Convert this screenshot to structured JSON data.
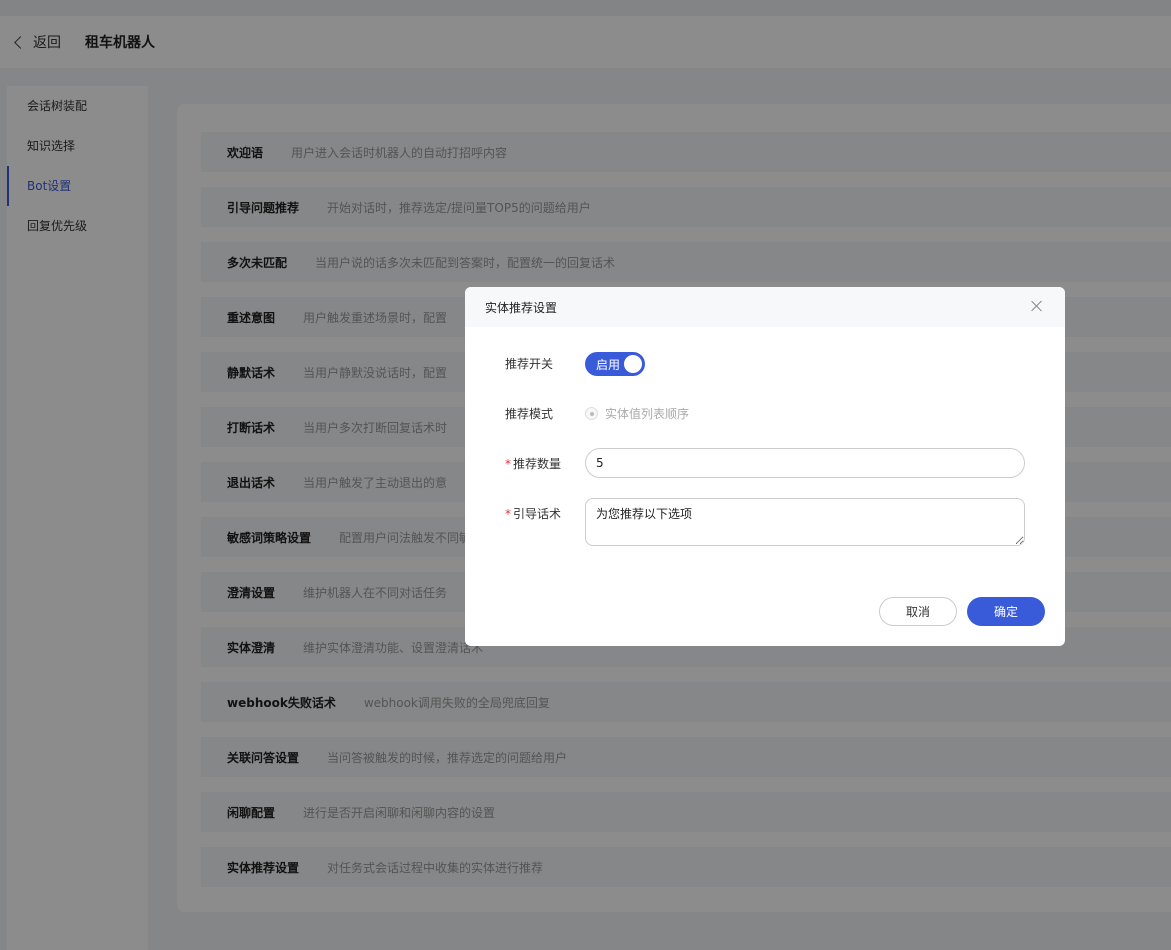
{
  "header": {
    "back_label": "返回",
    "title": "租车机器人"
  },
  "sidebar": {
    "items": [
      {
        "label": "会话树装配"
      },
      {
        "label": "知识选择"
      },
      {
        "label": "Bot设置"
      },
      {
        "label": "回复优先级"
      }
    ],
    "active_index": 2
  },
  "settings": [
    {
      "name": "欢迎语",
      "desc": "用户进入会话时机器人的自动打招呼内容"
    },
    {
      "name": "引导问题推荐",
      "desc": "开始对话时，推荐选定/提问量TOP5的问题给用户"
    },
    {
      "name": "多次未匹配",
      "desc": "当用户说的话多次未匹配到答案时，配置统一的回复话术"
    },
    {
      "name": "重述意图",
      "desc": "用户触发重述场景时，配置"
    },
    {
      "name": "静默话术",
      "desc": "当用户静默没说话时，配置"
    },
    {
      "name": "打断话术",
      "desc": "当用户多次打断回复话术时"
    },
    {
      "name": "退出话术",
      "desc": "当用户触发了主动退出的意"
    },
    {
      "name": "敏感词策略设置",
      "desc": "配置用户问法触发不同敏感"
    },
    {
      "name": "澄清设置",
      "desc": "维护机器人在不同对话任务"
    },
    {
      "name": "实体澄清",
      "desc": "维护实体澄清功能、设置澄清话术"
    },
    {
      "name": "webhook失败话术",
      "desc": "webhook调用失败的全局兜底回复"
    },
    {
      "name": "关联问答设置",
      "desc": "当问答被触发的时候，推荐选定的问题给用户"
    },
    {
      "name": "闲聊配置",
      "desc": "进行是否开启闲聊和闲聊内容的设置"
    },
    {
      "name": "实体推荐设置",
      "desc": "对任务式会话过程中收集的实体进行推荐"
    }
  ],
  "modal": {
    "title": "实体推荐设置",
    "switch_label": "推荐开关",
    "switch_text": "启用",
    "switch_on": true,
    "mode_label": "推荐模式",
    "mode_option": "实体值列表顺序",
    "count_label": "推荐数量",
    "count_value": "5",
    "prompt_label": "引导话术",
    "prompt_value": "为您推荐以下选项",
    "required_mark": "*",
    "cancel_label": "取消",
    "ok_label": "确定"
  },
  "colors": {
    "primary": "#3a5bd9",
    "required": "#ee3333"
  }
}
